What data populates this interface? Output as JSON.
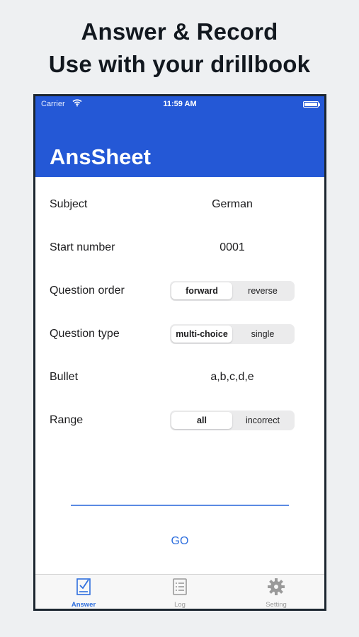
{
  "headline": {
    "line1": "Answer & Record",
    "line2": "Use with your drillbook"
  },
  "statusbar": {
    "carrier": "Carrier",
    "time": "11:59 AM"
  },
  "navbar": {
    "title": "AnsSheet"
  },
  "form": {
    "subject": {
      "label": "Subject",
      "value": "German"
    },
    "start_number": {
      "label": "Start number",
      "value": "0001"
    },
    "question_order": {
      "label": "Question order",
      "options": [
        "forward",
        "reverse"
      ],
      "selected": "forward"
    },
    "question_type": {
      "label": "Question type",
      "options": [
        "multi-choice",
        "single"
      ],
      "selected": "multi-choice"
    },
    "bullet": {
      "label": "Bullet",
      "value": "a,b,c,d,e"
    },
    "range": {
      "label": "Range",
      "options": [
        "all",
        "incorrect"
      ],
      "selected": "all"
    }
  },
  "go_button": {
    "label": "GO"
  },
  "tabbar": {
    "items": [
      {
        "label": "Answer",
        "icon": "answer-sheet-icon",
        "active": true
      },
      {
        "label": "Log",
        "icon": "log-list-icon",
        "active": false
      },
      {
        "label": "Setting",
        "icon": "gear-icon",
        "active": false
      }
    ]
  },
  "colors": {
    "accent": "#2458d6",
    "link": "#2f6fde",
    "tab_inactive": "#9a9a9a",
    "background": "#eef0f2"
  }
}
